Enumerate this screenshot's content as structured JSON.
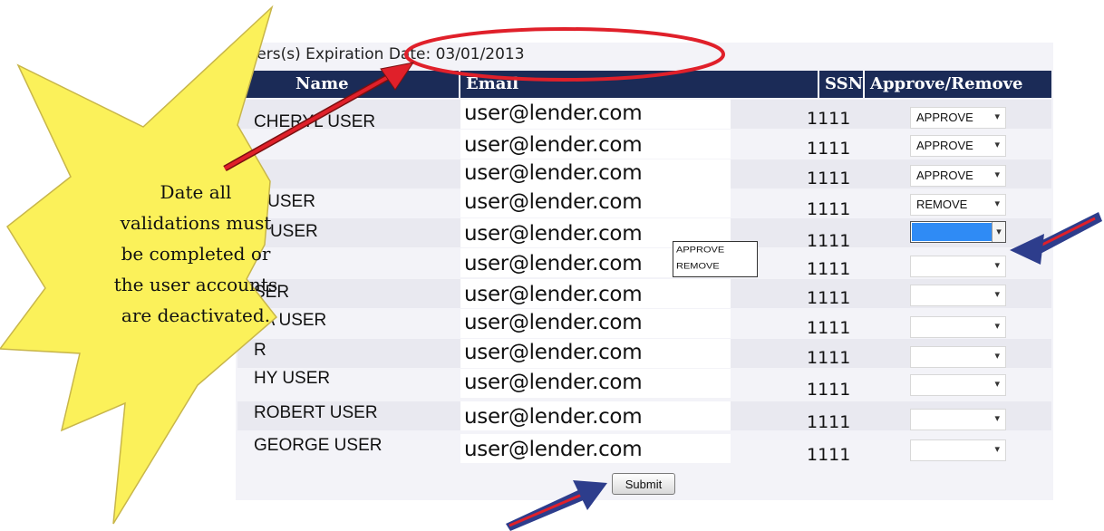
{
  "header": {
    "expiration_text": "Users(s) Expiration Date: 03/01/2013"
  },
  "table": {
    "columns": [
      "Name",
      "Email",
      "SSN",
      "Approve/Remove"
    ],
    "rows": [
      {
        "name": "CHERYL USER",
        "email": "user@lender.com",
        "ssn": "1111",
        "action": "APPROVE"
      },
      {
        "name": "",
        "email": "user@lender.com",
        "ssn": "1111",
        "action": "APPROVE"
      },
      {
        "name": "R",
        "email": "user@lender.com",
        "ssn": "1111",
        "action": "APPROVE"
      },
      {
        "name": "L USER",
        "email": "user@lender.com",
        "ssn": "1111",
        "action": "REMOVE"
      },
      {
        "name": "E USER",
        "email": "user@lender.com",
        "ssn": "1111",
        "action": ""
      },
      {
        "name": "",
        "email": "user@lender.com",
        "ssn": "1111",
        "action": ""
      },
      {
        "name": "SER",
        "email": "user@lender.com",
        "ssn": "1111",
        "action": ""
      },
      {
        "name": "LA USER",
        "email": "user@lender.com",
        "ssn": "1111",
        "action": ""
      },
      {
        "name": "R",
        "email": "user@lender.com",
        "ssn": "1111",
        "action": ""
      },
      {
        "name": "HY USER",
        "email": "user@lender.com",
        "ssn": "1111",
        "action": ""
      },
      {
        "name": "ROBERT USER",
        "email": "user@lender.com",
        "ssn": "1111",
        "action": ""
      },
      {
        "name": "GEORGE USER",
        "email": "user@lender.com",
        "ssn": "1111",
        "action": ""
      }
    ]
  },
  "dropdown_options": [
    "APPROVE",
    "REMOVE"
  ],
  "submit_label": "Submit",
  "callout": {
    "lines": [
      "Date all",
      "validations must",
      "be completed or",
      "the user accounts",
      "are deactivated."
    ]
  },
  "colors": {
    "header_bg": "#1b2b57",
    "starburst_fill": "#fbf15a",
    "arrow_red": "#e0202a",
    "arrow_blue": "#2d3d8c",
    "ellipse_red": "#e0202a"
  }
}
